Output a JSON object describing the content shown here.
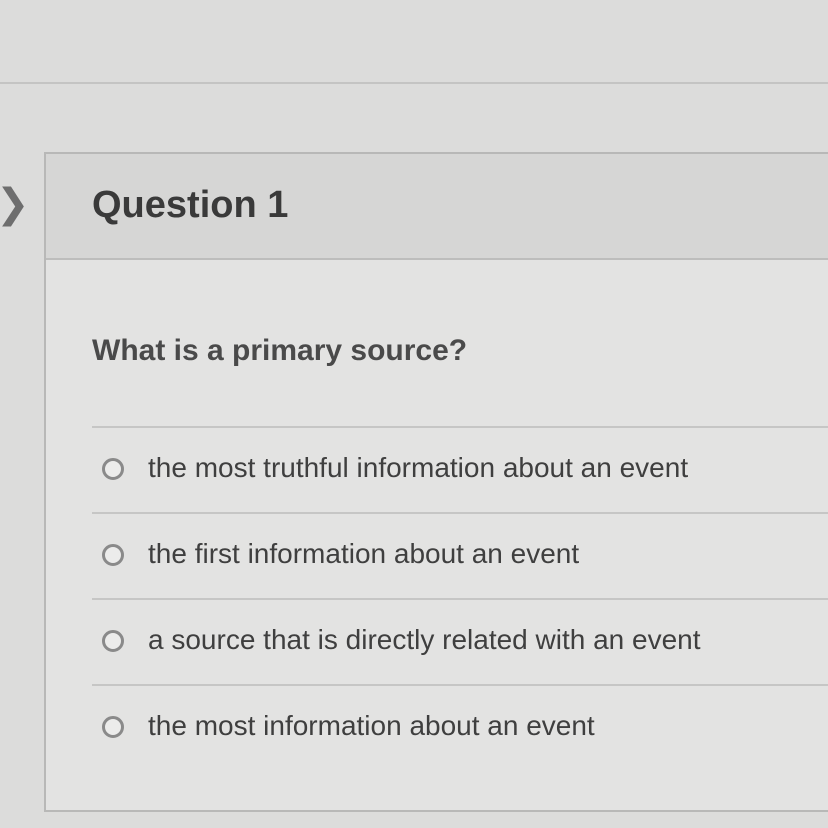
{
  "question": {
    "title": "Question 1",
    "prompt": "What is a primary source?",
    "options": [
      {
        "label": "the most truthful information about an event",
        "selected": false
      },
      {
        "label": "the first information about an event",
        "selected": false
      },
      {
        "label": "a source that is directly related with an event",
        "selected": false
      },
      {
        "label": "the most information about an event",
        "selected": false
      }
    ]
  },
  "icons": {
    "nav": "chevron-right-icon",
    "option": "radio-empty-icon"
  },
  "colors": {
    "background": "#dcdcdb",
    "header": "#d6d6d5",
    "text": "#3c3c3c"
  }
}
